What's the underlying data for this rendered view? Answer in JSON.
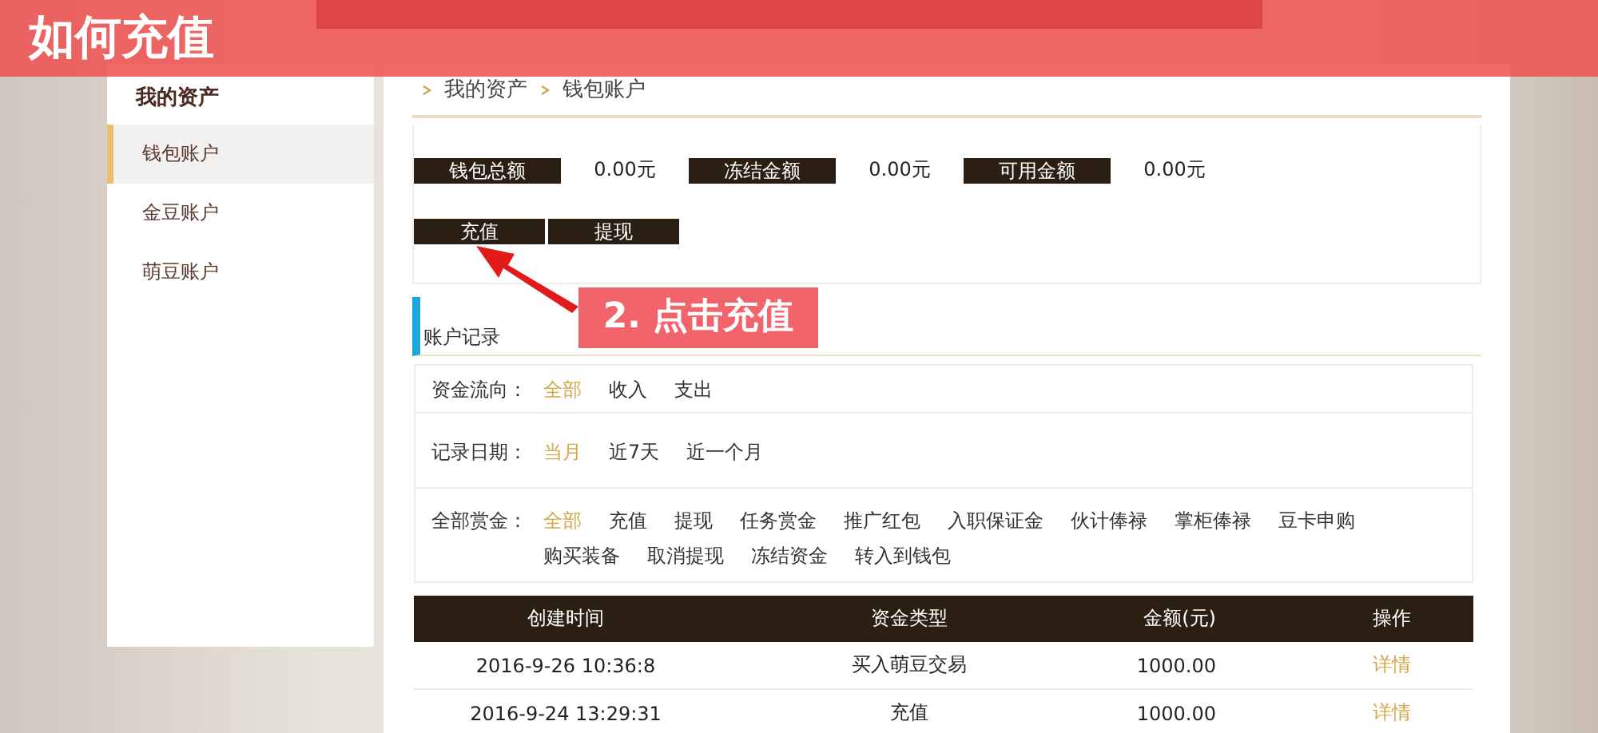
{
  "banner": {
    "title": "如何充值"
  },
  "sidebar": {
    "title": "我的资产",
    "items": [
      {
        "label": "钱包账户",
        "selected": true
      },
      {
        "label": "金豆账户",
        "selected": false
      },
      {
        "label": "萌豆账户",
        "selected": false
      }
    ]
  },
  "breadcrumb": [
    "我的资产",
    "钱包账户"
  ],
  "summary": [
    {
      "label": "钱包总额",
      "value": "0.00元"
    },
    {
      "label": "冻结金额",
      "value": "0.00元"
    },
    {
      "label": "可用金额",
      "value": "0.00元"
    }
  ],
  "actions": [
    "充值",
    "提现"
  ],
  "annotation": {
    "label": "2. 点击充值"
  },
  "section_title": "账户记录",
  "filters": [
    {
      "label": "资金流向：",
      "options": [
        {
          "label": "全部",
          "selected": true
        },
        {
          "label": "收入",
          "selected": false
        },
        {
          "label": "支出",
          "selected": false
        }
      ]
    },
    {
      "label": "记录日期：",
      "options": [
        {
          "label": "当月",
          "selected": true
        },
        {
          "label": "近7天",
          "selected": false
        },
        {
          "label": "近一个月",
          "selected": false
        }
      ]
    },
    {
      "label": "全部赏金：",
      "options": [
        {
          "label": "全部",
          "selected": true
        },
        {
          "label": "充值",
          "selected": false
        },
        {
          "label": "提现",
          "selected": false
        },
        {
          "label": "任务赏金",
          "selected": false
        },
        {
          "label": "推广红包",
          "selected": false
        },
        {
          "label": "入职保证金",
          "selected": false
        },
        {
          "label": "伙计俸禄",
          "selected": false
        },
        {
          "label": "掌柜俸禄",
          "selected": false
        },
        {
          "label": "豆卡申购",
          "selected": false
        },
        {
          "label": "购买装备",
          "selected": false
        },
        {
          "label": "取消提现",
          "selected": false
        },
        {
          "label": "冻结资金",
          "selected": false
        },
        {
          "label": "转入到钱包",
          "selected": false
        }
      ]
    }
  ],
  "table": {
    "columns": [
      "创建时间",
      "资金类型",
      "金额(元)",
      "操作"
    ],
    "rows": [
      {
        "cells": [
          "2016-9-26 10:36:8",
          "买入萌豆交易",
          "1000.00",
          "详情"
        ]
      },
      {
        "cells": [
          "2016-9-24 13:29:31",
          "充值",
          "1000.00",
          "详情"
        ]
      }
    ]
  }
}
